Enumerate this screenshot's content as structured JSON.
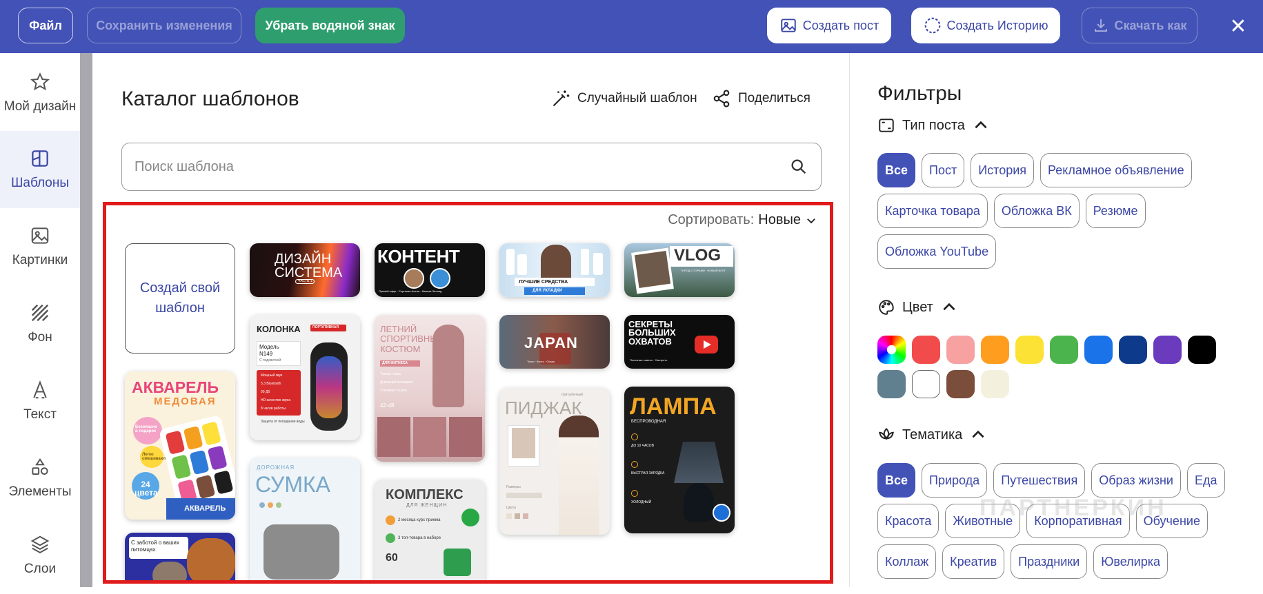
{
  "topbar": {
    "file": "Файл",
    "save": "Сохранить изменения",
    "remove_watermark": "Убрать водяной знак",
    "create_post": "Создать пост",
    "create_story": "Создать Историю",
    "download_as": "Скачать как",
    "close": "✕"
  },
  "sidebar": {
    "items": [
      {
        "label": "Мой дизайн",
        "icon": "star-icon"
      },
      {
        "label": "Шаблоны",
        "icon": "template-icon"
      },
      {
        "label": "Картинки",
        "icon": "image-icon"
      },
      {
        "label": "Фон",
        "icon": "background-icon"
      },
      {
        "label": "Текст",
        "icon": "text-icon"
      },
      {
        "label": "Элементы",
        "icon": "elements-icon"
      },
      {
        "label": "Слои",
        "icon": "layers-icon"
      }
    ]
  },
  "main": {
    "title": "Каталог шаблонов",
    "random_template": "Случайный шаблон",
    "share": "Поделиться",
    "search_placeholder": "Поиск шаблона",
    "sort_label": "Сортировать:",
    "sort_value": "Новые",
    "create_own": "Создай свой шаблон"
  },
  "templates": [
    {
      "title": "ДИЗАЙН СИСТЕМА",
      "sub": "ЧАСТЬ 1"
    },
    {
      "title": "КОНТЕНТ",
      "sub": "Прямой эфир · Сергеева Алена · Иванов Леонид"
    },
    {
      "title": "ЛУЧШИЕ СРЕДСТВА",
      "sub": "ДЛЯ УКЛАДКИ"
    },
    {
      "title": "VLOG",
      "sub": "ГОРОД С ГОРАМИ · НОВЫЙ ВЛОГ"
    },
    {
      "title": "КОЛОНКА",
      "badge": "ПОРТАТИВНАЯ",
      "model": "Модель N149",
      "sub": "С подсветкой",
      "lines": [
        "Мощный звук",
        "5.3 Bluetooth",
        "90 Дб",
        "HD-качество звука",
        "8 часов работы",
        "Защита от попадания воды"
      ]
    },
    {
      "title": "ЛЕТНИЙ СПОРТИВНЫЙ КОСТЮМ",
      "sub": "ДЛЯ ФИТНЕСА",
      "lines": [
        "Тонкая ткань",
        "Дышащий материал",
        "Утягивает талию",
        "42-48"
      ]
    },
    {
      "title": "JAPAN",
      "sub": "Токио · Киото · Осака"
    },
    {
      "title": "СЕКРЕТЫ БОЛЬШИХ ОХВАТОВ",
      "sub": "Полезные советы · Смотреть"
    },
    {
      "title": "АКВАРЕЛЬ",
      "sub": "МЕДОВАЯ",
      "lines": [
        "Безопасно в подарок",
        "Легко смешиваются",
        "24 цвета"
      ],
      "brand": "АКВАРЕЛЬ"
    },
    {
      "title": "ПИДЖАК",
      "sub": "приталенный",
      "lines": [
        "Размеры",
        "Цвета"
      ]
    },
    {
      "title": "ЛАМПА",
      "sub": "БЕСПРОВОДНАЯ",
      "lines": [
        "ДО 10 ЧАСОВ",
        "БЫСТРАЯ ЗАРЯДКА",
        "ХОЛОДНЫЙ"
      ]
    },
    {
      "title": "СУМКА",
      "sub": "ДОРОЖНАЯ"
    },
    {
      "title": "КОМПЛЕКС",
      "sub": "ДЛЯ ЖЕНЩИН",
      "lines": [
        "2 месяца курс приема",
        "3 топ-товара в наборе",
        "60"
      ]
    },
    {
      "title": "С заботой о ваших питомцах"
    }
  ],
  "filters": {
    "title": "Фильтры",
    "post_type_label": "Тип поста",
    "post_types": [
      "Все",
      "Пост",
      "История",
      "Рекламное объявление",
      "Карточка товара",
      "Обложка ВК",
      "Резюме",
      "Обложка YouTube"
    ],
    "color_label": "Цвет",
    "colors": [
      "rainbow",
      "#f24b4b",
      "#f7a1a1",
      "#ff9d1f",
      "#fbe235",
      "#4cb44c",
      "#1a73e8",
      "#0d3a8a",
      "#6a3bbd",
      "#000000",
      "#60808f",
      "#ffffff",
      "#7a4e3a",
      "#f3f1de"
    ],
    "theme_label": "Тематика",
    "themes": [
      "Все",
      "Природа",
      "Путешествия",
      "Образ жизни",
      "Еда",
      "Красота",
      "Животные",
      "Корпоративная",
      "Обучение",
      "Коллаж",
      "Креатив",
      "Праздники",
      "Ювелирка"
    ]
  },
  "watermark": "ПАРТНЕРКИН"
}
